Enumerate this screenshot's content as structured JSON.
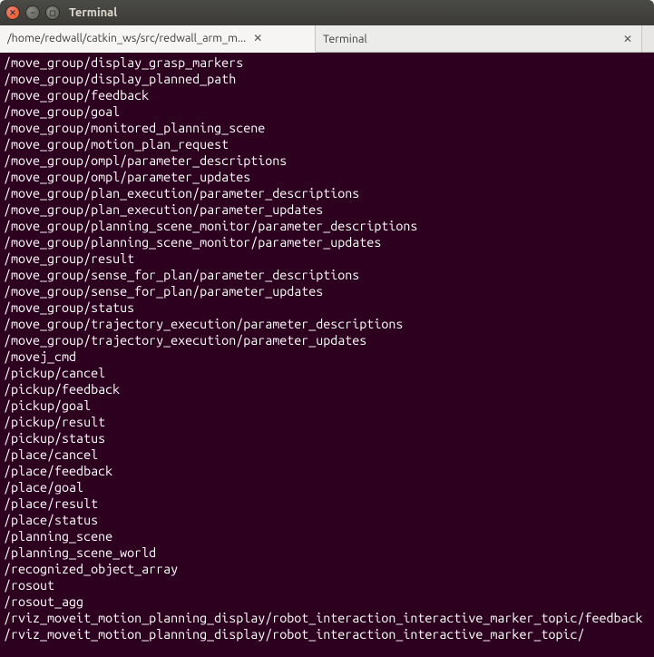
{
  "window": {
    "title": "Terminal"
  },
  "tabs": [
    {
      "label": "/home/redwall/catkin_ws/src/redwall_arm_m...",
      "active": true
    },
    {
      "label": "Terminal",
      "active": false
    }
  ],
  "terminal_lines": [
    "/move_group/display_grasp_markers",
    "/move_group/display_planned_path",
    "/move_group/feedback",
    "/move_group/goal",
    "/move_group/monitored_planning_scene",
    "/move_group/motion_plan_request",
    "/move_group/ompl/parameter_descriptions",
    "/move_group/ompl/parameter_updates",
    "/move_group/plan_execution/parameter_descriptions",
    "/move_group/plan_execution/parameter_updates",
    "/move_group/planning_scene_monitor/parameter_descriptions",
    "/move_group/planning_scene_monitor/parameter_updates",
    "/move_group/result",
    "/move_group/sense_for_plan/parameter_descriptions",
    "/move_group/sense_for_plan/parameter_updates",
    "/move_group/status",
    "/move_group/trajectory_execution/parameter_descriptions",
    "/move_group/trajectory_execution/parameter_updates",
    "/movej_cmd",
    "/pickup/cancel",
    "/pickup/feedback",
    "/pickup/goal",
    "/pickup/result",
    "/pickup/status",
    "/place/cancel",
    "/place/feedback",
    "/place/goal",
    "/place/result",
    "/place/status",
    "/planning_scene",
    "/planning_scene_world",
    "/recognized_object_array",
    "/rosout",
    "/rosout_agg",
    "/rviz_moveit_motion_planning_display/robot_interaction_interactive_marker_topic/feedback",
    "/rviz_moveit_motion_planning_display/robot_interaction_interactive_marker_topic/"
  ]
}
